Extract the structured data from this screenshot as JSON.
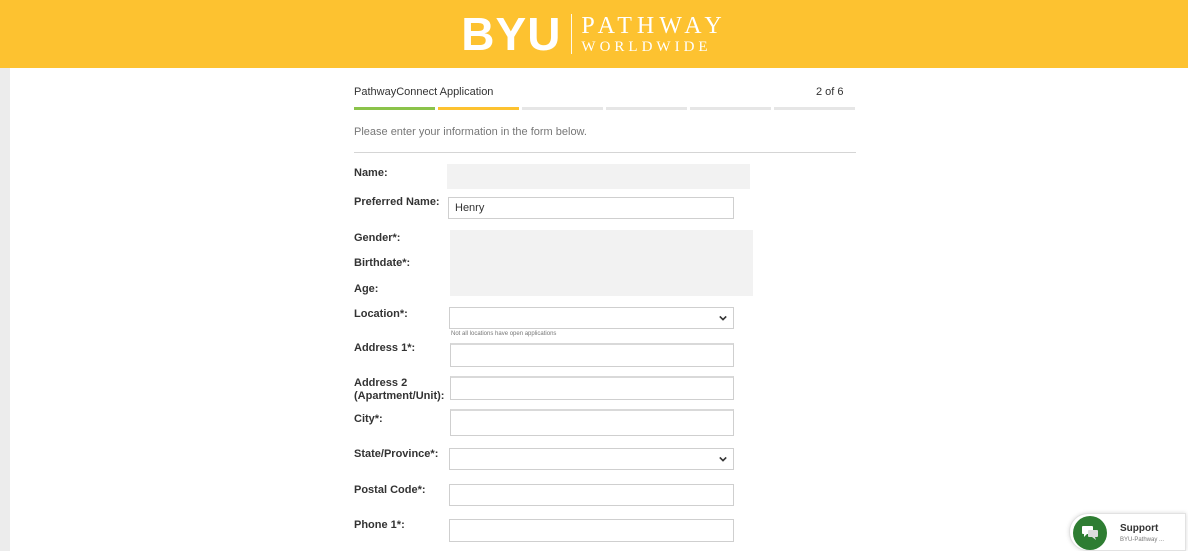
{
  "brand": {
    "main": "BYU",
    "line1": "PATHWAY",
    "line2": "WORLDWIDE",
    "color": "#fdc230"
  },
  "app": {
    "title": "PathwayConnect Application",
    "step": "2 of 6",
    "current_step": 2,
    "total_steps": 6
  },
  "progress_colors": {
    "done": "#8bc34a",
    "current": "#fdc230",
    "pending": "#e6e6e6"
  },
  "intro": "Please enter your information in the form below.",
  "form": {
    "name_label": "Name:",
    "preferred_name_label": "Preferred Name:",
    "preferred_name_value": "Henry",
    "gender_label": "Gender*:",
    "birthdate_label": "Birthdate*:",
    "age_label": "Age:",
    "location_label": "Location*:",
    "location_hint": "Not all locations have open applications",
    "address1_label": "Address 1*:",
    "address2_label": "Address 2 (Apartment/Unit):",
    "city_label": "City*:",
    "state_label": "State/Province*:",
    "postal_label": "Postal Code*:",
    "phone_label": "Phone 1*:"
  },
  "support": {
    "title": "Support",
    "subtitle": "BYU-Pathway ...",
    "icon": "chat-icon",
    "color": "#2e7d32"
  }
}
